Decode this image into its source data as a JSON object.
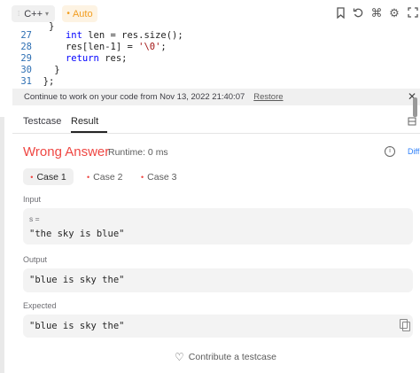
{
  "toolbar": {
    "language": "C++",
    "mode": "Auto",
    "icons": [
      "bookmark-icon",
      "reset-icon",
      "command-icon",
      "settings-icon",
      "expand-icon"
    ]
  },
  "code": {
    "lines": [
      {
        "num": "27",
        "indent": "    ",
        "tokens": [
          {
            "t": "kw",
            "v": "int"
          },
          {
            "t": "txt",
            "v": " len = res.size();"
          }
        ]
      },
      {
        "num": "28",
        "indent": "    ",
        "tokens": [
          {
            "t": "txt",
            "v": "res[len-1] = "
          },
          {
            "t": "str",
            "v": "'\\0'"
          },
          {
            "t": "txt",
            "v": ";"
          }
        ]
      },
      {
        "num": "29",
        "indent": "    ",
        "tokens": [
          {
            "t": "kw",
            "v": "return"
          },
          {
            "t": "txt",
            "v": " res;"
          }
        ]
      },
      {
        "num": "30",
        "indent": "  ",
        "tokens": [
          {
            "t": "txt",
            "v": "}"
          }
        ]
      },
      {
        "num": "31",
        "indent": "",
        "tokens": [
          {
            "t": "txt",
            "v": "};"
          }
        ]
      }
    ]
  },
  "restore_bar": {
    "message": "Continue to work on your code from Nov 13, 2022 21:40:07",
    "link": "Restore"
  },
  "tabs": [
    {
      "label": "Testcase",
      "active": false
    },
    {
      "label": "Result",
      "active": true
    }
  ],
  "result": {
    "status": "Wrong Answer",
    "runtime": "Runtime: 0 ms",
    "diff_label": "Diff",
    "status_color": "#ef4743"
  },
  "cases": [
    {
      "label": "Case 1",
      "active": true
    },
    {
      "label": "Case 2",
      "active": false
    },
    {
      "label": "Case 3",
      "active": false
    }
  ],
  "input": {
    "label": "Input",
    "var_name": "s =",
    "value": "\"the sky is blue\""
  },
  "output": {
    "label": "Output",
    "value": "\"blue is sky the\""
  },
  "expected": {
    "label": "Expected",
    "value": "\"blue is sky the\""
  },
  "contribute": {
    "label": "Contribute a testcase"
  }
}
